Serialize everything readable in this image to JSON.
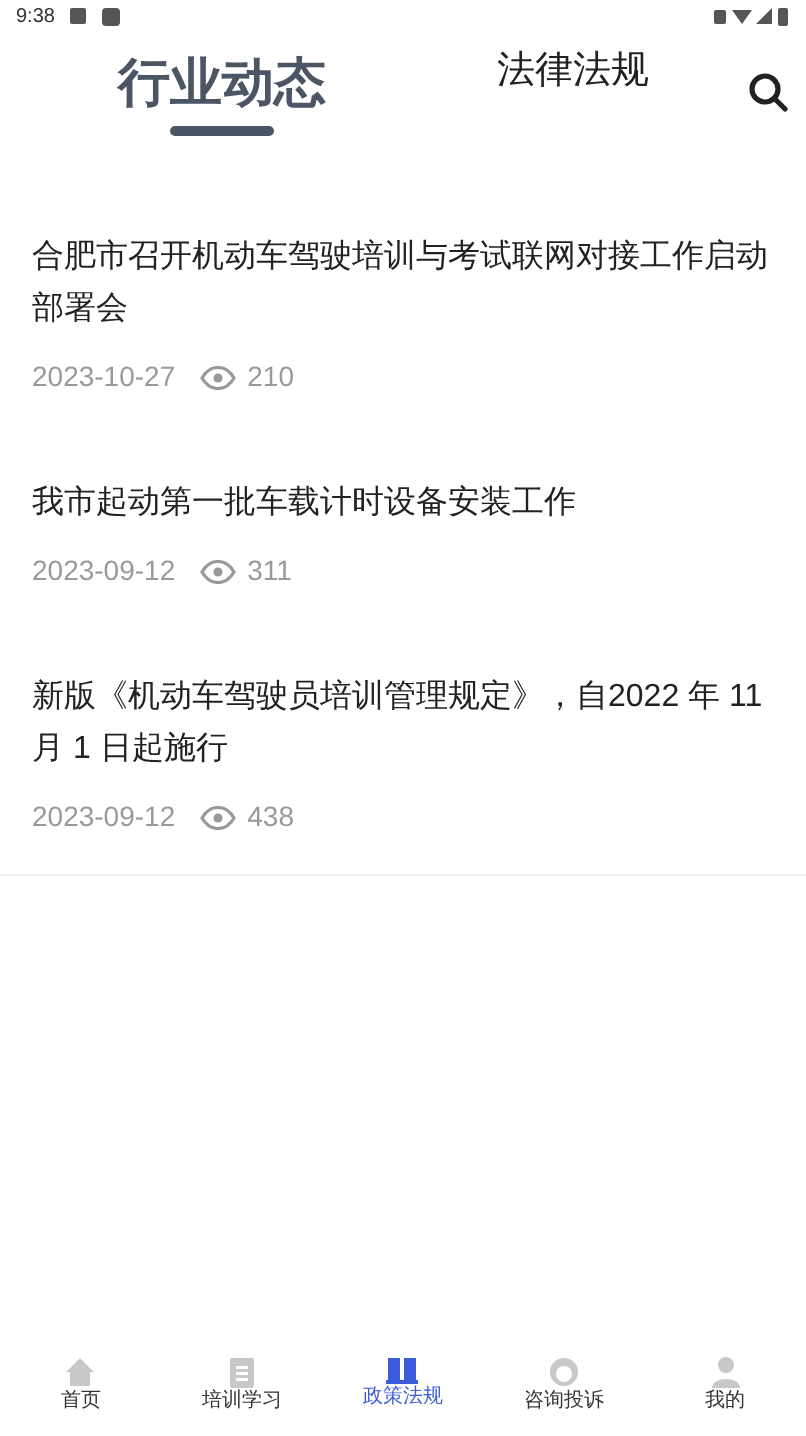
{
  "status_bar": {
    "time": "9:38"
  },
  "tabs": [
    {
      "label": "行业动态",
      "selected": true
    },
    {
      "label": "法律法规",
      "selected": false
    }
  ],
  "articles": [
    {
      "title": "合肥市召开机动车驾驶培训与考试联网对接工作启动部署会",
      "date": "2023-10-27",
      "views": "210"
    },
    {
      "title": "我市起动第一批车载计时设备安装工作",
      "date": "2023-09-12",
      "views": "311"
    },
    {
      "title": "新版《机动车驾驶员培训管理规定》，自2022 年 11 月 1 日起施行",
      "date": "2023-09-12",
      "views": "438"
    }
  ],
  "bottom_nav": [
    {
      "kind": "home",
      "label": "首页",
      "selected": false
    },
    {
      "kind": "study",
      "label": "培训学习",
      "selected": false
    },
    {
      "kind": "book",
      "label": "政策法规",
      "selected": true
    },
    {
      "kind": "service",
      "label": "咨询投诉",
      "selected": false
    },
    {
      "kind": "user",
      "label": "我的",
      "selected": false
    }
  ]
}
